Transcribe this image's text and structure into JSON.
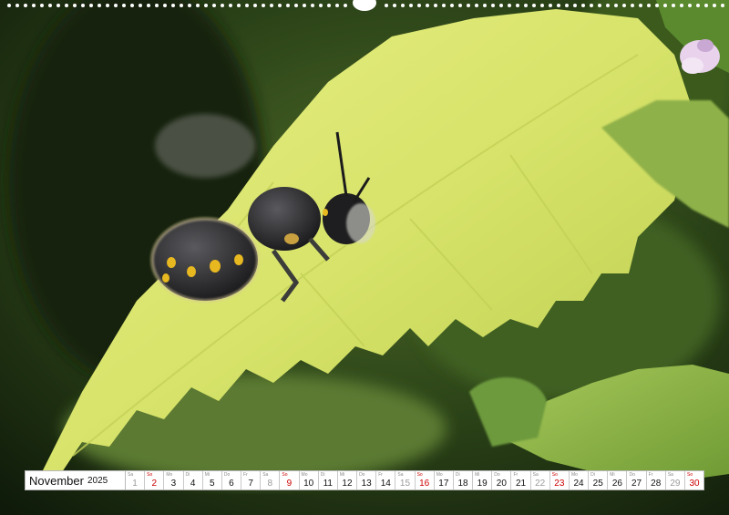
{
  "calendar": {
    "month": "November",
    "year": "2025",
    "days": [
      {
        "wd": "Sa",
        "d": "1",
        "t": "sat"
      },
      {
        "wd": "So",
        "d": "2",
        "t": "sun"
      },
      {
        "wd": "Mo",
        "d": "3",
        "t": "wk"
      },
      {
        "wd": "Di",
        "d": "4",
        "t": "wk"
      },
      {
        "wd": "Mi",
        "d": "5",
        "t": "wk"
      },
      {
        "wd": "Do",
        "d": "6",
        "t": "wk"
      },
      {
        "wd": "Fr",
        "d": "7",
        "t": "wk"
      },
      {
        "wd": "Sa",
        "d": "8",
        "t": "sat"
      },
      {
        "wd": "So",
        "d": "9",
        "t": "sun"
      },
      {
        "wd": "Mo",
        "d": "10",
        "t": "wk"
      },
      {
        "wd": "Di",
        "d": "11",
        "t": "wk"
      },
      {
        "wd": "Mi",
        "d": "12",
        "t": "wk"
      },
      {
        "wd": "Do",
        "d": "13",
        "t": "wk"
      },
      {
        "wd": "Fr",
        "d": "14",
        "t": "wk"
      },
      {
        "wd": "Sa",
        "d": "15",
        "t": "sat"
      },
      {
        "wd": "So",
        "d": "16",
        "t": "sun"
      },
      {
        "wd": "Mo",
        "d": "17",
        "t": "wk"
      },
      {
        "wd": "Di",
        "d": "18",
        "t": "wk"
      },
      {
        "wd": "Mi",
        "d": "19",
        "t": "wk"
      },
      {
        "wd": "Do",
        "d": "20",
        "t": "wk"
      },
      {
        "wd": "Fr",
        "d": "21",
        "t": "wk"
      },
      {
        "wd": "Sa",
        "d": "22",
        "t": "sat"
      },
      {
        "wd": "So",
        "d": "23",
        "t": "sun"
      },
      {
        "wd": "Mo",
        "d": "24",
        "t": "wk"
      },
      {
        "wd": "Di",
        "d": "25",
        "t": "wk"
      },
      {
        "wd": "Mi",
        "d": "26",
        "t": "wk"
      },
      {
        "wd": "Do",
        "d": "27",
        "t": "wk"
      },
      {
        "wd": "Fr",
        "d": "28",
        "t": "wk"
      },
      {
        "wd": "Sa",
        "d": "29",
        "t": "sat"
      },
      {
        "wd": "So",
        "d": "30",
        "t": "sun"
      }
    ]
  },
  "photo": {
    "subject": "bee-in-flight",
    "colors": {
      "leaf": "#d6e46a",
      "background": "#1f3316",
      "bee_body": "#2b2b2e",
      "bee_spots": "#e8b820",
      "flower": "#e8d2ec"
    }
  }
}
